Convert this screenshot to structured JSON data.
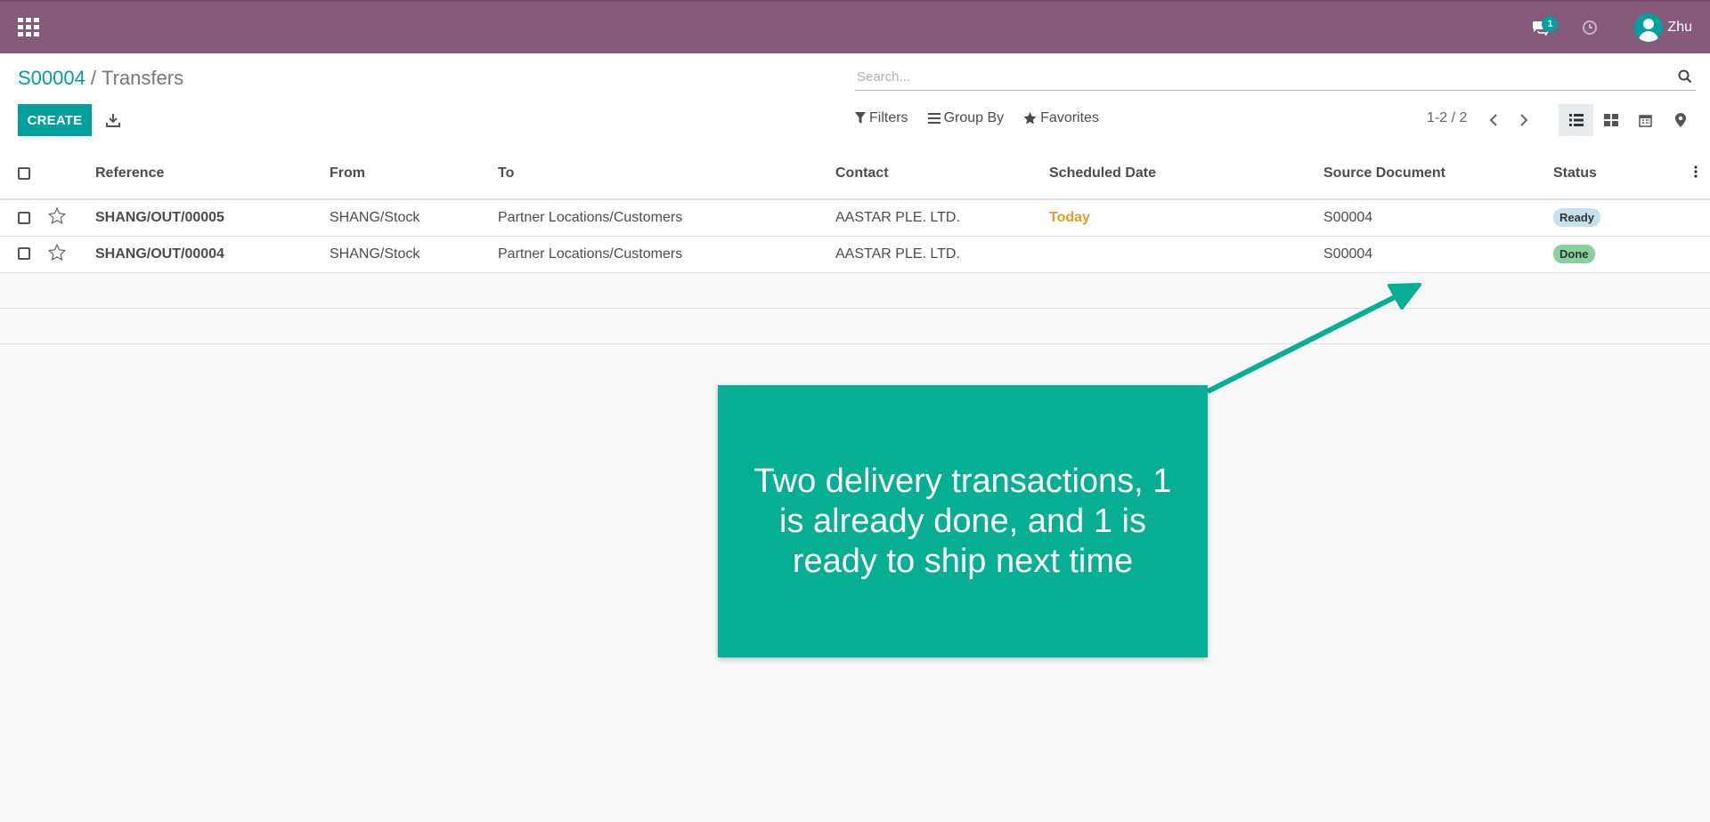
{
  "navbar": {
    "chat_count": "1",
    "user_name": "Zhu",
    "bg_color": "#875a7b",
    "icons": [
      "apps-icon",
      "chat-icon",
      "clock-icon",
      "avatar"
    ]
  },
  "breadcrumb": {
    "parent": "S00004",
    "separator": "/",
    "current": "Transfers"
  },
  "search": {
    "placeholder": "Search..."
  },
  "toolbar": {
    "create_label": "CREATE",
    "filters_label": "Filters",
    "group_by_label": "Group By",
    "favorites_label": "Favorites",
    "pager_text": "1-2 / 2"
  },
  "table": {
    "headers": {
      "reference": "Reference",
      "from": "From",
      "to": "To",
      "contact": "Contact",
      "scheduled_date": "Scheduled Date",
      "source_document": "Source Document",
      "status": "Status"
    },
    "rows": [
      {
        "reference": "SHANG/OUT/00005",
        "from": "SHANG/Stock",
        "to": "Partner Locations/Customers",
        "contact": "AASTAR PLE. LTD.",
        "scheduled_date": "Today",
        "source_document": "S00004",
        "status": "Ready"
      },
      {
        "reference": "SHANG/OUT/00004",
        "from": "SHANG/Stock",
        "to": "Partner Locations/Customers",
        "contact": "AASTAR PLE. LTD.",
        "scheduled_date": "",
        "source_document": "S00004",
        "status": "Done"
      }
    ]
  },
  "annotation": {
    "text": "Two delivery transactions, 1 is already done, and 1 is ready to ship next time",
    "color": "#06ae93"
  },
  "colors": {
    "accent": "#00a09d",
    "today": "#e2a022",
    "ready_badge": "#c7e1ec",
    "done_badge": "#86d29c"
  }
}
